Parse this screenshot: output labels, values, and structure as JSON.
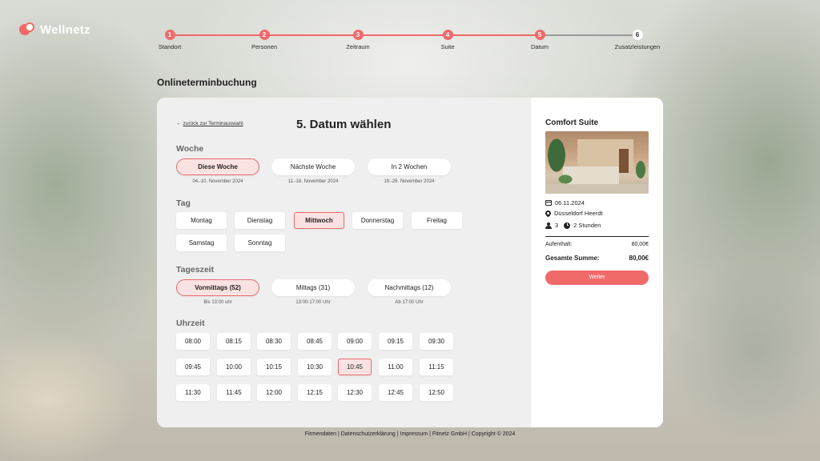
{
  "brand": {
    "name": "Wellnetz",
    "colors": {
      "accent": "#f06a6a",
      "active_bg": "#fbe2e2"
    }
  },
  "stepper": {
    "steps": [
      {
        "num": "1",
        "label": "Standort"
      },
      {
        "num": "2",
        "label": "Personen"
      },
      {
        "num": "3",
        "label": "Zeitraum"
      },
      {
        "num": "4",
        "label": "Suite"
      },
      {
        "num": "5",
        "label": "Datum"
      },
      {
        "num": "6",
        "label": "Zusatzleistungen"
      }
    ],
    "current_step": 5
  },
  "page_title": "Onlineterminbuchung",
  "booking": {
    "back_link": "zurück zur Terminauswahl",
    "title": "5. Datum wählen",
    "week": {
      "label": "Woche",
      "options": [
        {
          "label": "Diese Woche",
          "sub": "04.-10. November 2024",
          "active": true
        },
        {
          "label": "Nächste Woche",
          "sub": "11.-18. November 2024",
          "active": false
        },
        {
          "label": "In 2 Wochen",
          "sub": "19.-26. November 2024",
          "active": false
        }
      ]
    },
    "day": {
      "label": "Tag",
      "options": [
        "Montag",
        "Dienstag",
        "Mittwoch",
        "Donnerstag",
        "Freitag",
        "Samstag",
        "Sonntag"
      ],
      "selected": "Mittwoch"
    },
    "daytime": {
      "label": "Tageszeit",
      "options": [
        {
          "label": "Vormittags (52)",
          "sub": "Bis 13:00 uhr",
          "active": true
        },
        {
          "label": "Mittags (31)",
          "sub": "13:00-17:00 Uhr",
          "active": false
        },
        {
          "label": "Nachmittags (12)",
          "sub": "Ab 17:00 Uhr",
          "active": false
        }
      ]
    },
    "time": {
      "label": "Uhrzeit",
      "options": [
        "08:00",
        "08:15",
        "08:30",
        "08:45",
        "09:00",
        "09:15",
        "09:30",
        "09:45",
        "10:00",
        "10:15",
        "10:30",
        "10:45",
        "11:00",
        "11:15",
        "11:30",
        "11:45",
        "12:00",
        "12:15",
        "12:30",
        "12:45",
        "12:50"
      ],
      "selected": "10:45"
    }
  },
  "summary": {
    "title": "Comfort Suite",
    "date": "06.11.2024",
    "location": "Düsseldorf Heerdt",
    "persons": "3",
    "duration": "2 Stunden",
    "stay_label": "Aufenthalt:",
    "stay_value": "80,00€",
    "total_label": "Gesamte Summe:",
    "total_value": "80,00€",
    "next_button": "Weiter"
  },
  "footer": "Firmendaten | Datenschutzerklärung | Impressum | Fitnetz GmbH | Copyright © 2024"
}
